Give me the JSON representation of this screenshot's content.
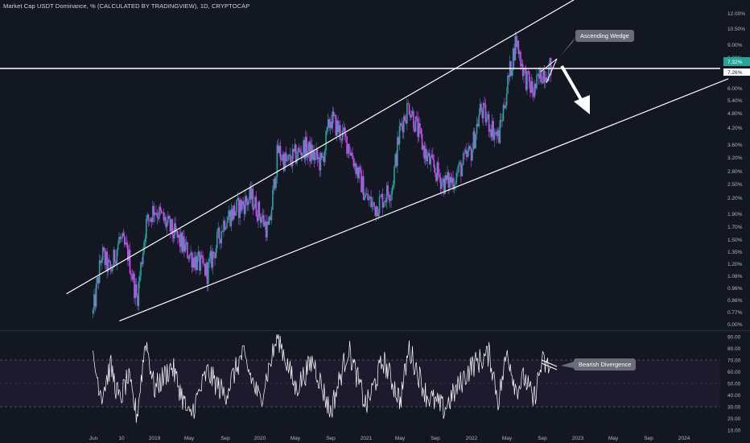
{
  "header": {
    "title": "Market Cap USDT Dominance, % (CALCULATED BY TRADINGVIEW), 1D, CRYPTOCAP"
  },
  "annotations": {
    "wedge_label": "Ascending Wedge",
    "divergence_label": "Bearish Divergence"
  },
  "price_axis": {
    "ticks": [
      "12.00%",
      "10.50%",
      "9.00%",
      "8.00%",
      "6.00%",
      "5.40%",
      "4.80%",
      "4.20%",
      "3.60%",
      "3.20%",
      "2.80%",
      "2.50%",
      "2.20%",
      "1.90%",
      "1.70%",
      "1.50%",
      "1.35%",
      "1.20%",
      "1.08%",
      "0.96%",
      "0.86%",
      "0.77%",
      "0.00%"
    ],
    "current_price": "7.32%",
    "horizontal_level": "7.26%",
    "current_color": "#26a69a"
  },
  "rsi_axis": {
    "ticks": [
      "90.00",
      "80.00",
      "70.00",
      "60.00",
      "50.00",
      "40.00",
      "30.00",
      "20.00",
      "10.00"
    ],
    "upper_band": 70,
    "lower_band": 30
  },
  "time_axis": {
    "labels": [
      "Jun",
      "10",
      "2019",
      "May",
      "Sep",
      "2020",
      "May",
      "Sep",
      "2021",
      "May",
      "Sep",
      "2022",
      "May",
      "Sep",
      "2023",
      "May",
      "Sep",
      "2024"
    ]
  },
  "chart_data": {
    "type": "candlestick",
    "symbol": "USDT.D",
    "interval": "1D",
    "y_scale": "log",
    "price_range_percent": [
      0.7,
      13
    ],
    "price_series_approx": [
      {
        "date": "2018-06",
        "value": 0.75
      },
      {
        "date": "2018-07",
        "value": 1.3
      },
      {
        "date": "2018-08",
        "value": 1.1
      },
      {
        "date": "2018-09",
        "value": 1.5
      },
      {
        "date": "2018-10",
        "value": 1.3
      },
      {
        "date": "2018-11",
        "value": 0.85
      },
      {
        "date": "2018-12",
        "value": 1.7
      },
      {
        "date": "2019-01",
        "value": 2.0
      },
      {
        "date": "2019-03",
        "value": 1.6
      },
      {
        "date": "2019-05",
        "value": 1.3
      },
      {
        "date": "2019-07",
        "value": 1.1
      },
      {
        "date": "2019-09",
        "value": 1.8
      },
      {
        "date": "2019-12",
        "value": 2.2
      },
      {
        "date": "2020-02",
        "value": 1.6
      },
      {
        "date": "2020-03",
        "value": 3.4
      },
      {
        "date": "2020-04",
        "value": 3.0
      },
      {
        "date": "2020-06",
        "value": 3.5
      },
      {
        "date": "2020-08",
        "value": 3.0
      },
      {
        "date": "2020-09",
        "value": 4.6
      },
      {
        "date": "2020-11",
        "value": 3.6
      },
      {
        "date": "2021-01",
        "value": 2.2
      },
      {
        "date": "2021-02",
        "value": 2.0
      },
      {
        "date": "2021-04",
        "value": 2.4
      },
      {
        "date": "2021-05",
        "value": 4.2
      },
      {
        "date": "2021-06",
        "value": 5.2
      },
      {
        "date": "2021-08",
        "value": 3.2
      },
      {
        "date": "2021-10",
        "value": 2.5
      },
      {
        "date": "2021-11",
        "value": 2.6
      },
      {
        "date": "2022-01",
        "value": 3.4
      },
      {
        "date": "2022-02",
        "value": 5.0
      },
      {
        "date": "2022-04",
        "value": 3.8
      },
      {
        "date": "2022-05",
        "value": 6.2
      },
      {
        "date": "2022-06",
        "value": 9.5
      },
      {
        "date": "2022-07",
        "value": 6.8
      },
      {
        "date": "2022-08",
        "value": 5.8
      },
      {
        "date": "2022-09",
        "value": 7.0
      },
      {
        "date": "2022-10",
        "value": 7.3
      }
    ],
    "channel": {
      "upper": [
        {
          "date": "2018-03",
          "value": 0.9
        },
        {
          "date": "2023-01",
          "value": 14
        }
      ],
      "lower": [
        {
          "date": "2018-09",
          "value": 0.7
        },
        {
          "date": "2024-06",
          "value": 6.6
        }
      ]
    },
    "horizontal_line": 7.26,
    "rsi_series_approx": [
      {
        "date": "2018-06",
        "value": 70
      },
      {
        "date": "2018-07",
        "value": 40
      },
      {
        "date": "2018-08",
        "value": 65
      },
      {
        "date": "2018-09",
        "value": 35
      },
      {
        "date": "2018-10",
        "value": 55
      },
      {
        "date": "2018-11",
        "value": 22
      },
      {
        "date": "2018-12",
        "value": 88
      },
      {
        "date": "2019-01",
        "value": 45
      },
      {
        "date": "2019-03",
        "value": 65
      },
      {
        "date": "2019-05",
        "value": 20
      },
      {
        "date": "2019-07",
        "value": 60
      },
      {
        "date": "2019-09",
        "value": 40
      },
      {
        "date": "2019-11",
        "value": 75
      },
      {
        "date": "2020-01",
        "value": 35
      },
      {
        "date": "2020-03",
        "value": 91
      },
      {
        "date": "2020-05",
        "value": 45
      },
      {
        "date": "2020-07",
        "value": 70
      },
      {
        "date": "2020-09",
        "value": 25
      },
      {
        "date": "2020-11",
        "value": 80
      },
      {
        "date": "2021-01",
        "value": 30
      },
      {
        "date": "2021-03",
        "value": 70
      },
      {
        "date": "2021-05",
        "value": 35
      },
      {
        "date": "2021-06",
        "value": 80
      },
      {
        "date": "2021-08",
        "value": 40
      },
      {
        "date": "2021-10",
        "value": 28
      },
      {
        "date": "2022-01",
        "value": 65
      },
      {
        "date": "2022-03",
        "value": 75
      },
      {
        "date": "2022-04",
        "value": 35
      },
      {
        "date": "2022-05",
        "value": 78
      },
      {
        "date": "2022-06",
        "value": 45
      },
      {
        "date": "2022-07",
        "value": 55
      },
      {
        "date": "2022-08",
        "value": 35
      },
      {
        "date": "2022-09",
        "value": 68
      },
      {
        "date": "2022-10",
        "value": 62
      }
    ],
    "colors": {
      "up": "#26a69a",
      "down": "#e040fb",
      "lines": "#ffffff",
      "rsi": "#ffffff"
    }
  }
}
